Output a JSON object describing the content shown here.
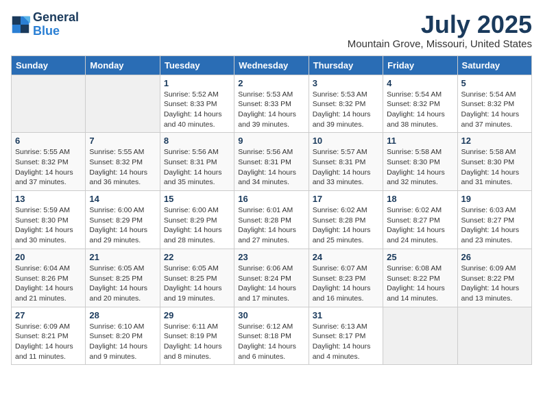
{
  "logo": {
    "line1": "General",
    "line2": "Blue"
  },
  "title": "July 2025",
  "location": "Mountain Grove, Missouri, United States",
  "headers": [
    "Sunday",
    "Monday",
    "Tuesday",
    "Wednesday",
    "Thursday",
    "Friday",
    "Saturday"
  ],
  "weeks": [
    [
      {
        "day": "",
        "empty": true
      },
      {
        "day": "",
        "empty": true
      },
      {
        "day": "1",
        "sunrise": "Sunrise: 5:52 AM",
        "sunset": "Sunset: 8:33 PM",
        "daylight": "Daylight: 14 hours and 40 minutes."
      },
      {
        "day": "2",
        "sunrise": "Sunrise: 5:53 AM",
        "sunset": "Sunset: 8:33 PM",
        "daylight": "Daylight: 14 hours and 39 minutes."
      },
      {
        "day": "3",
        "sunrise": "Sunrise: 5:53 AM",
        "sunset": "Sunset: 8:32 PM",
        "daylight": "Daylight: 14 hours and 39 minutes."
      },
      {
        "day": "4",
        "sunrise": "Sunrise: 5:54 AM",
        "sunset": "Sunset: 8:32 PM",
        "daylight": "Daylight: 14 hours and 38 minutes."
      },
      {
        "day": "5",
        "sunrise": "Sunrise: 5:54 AM",
        "sunset": "Sunset: 8:32 PM",
        "daylight": "Daylight: 14 hours and 37 minutes."
      }
    ],
    [
      {
        "day": "6",
        "sunrise": "Sunrise: 5:55 AM",
        "sunset": "Sunset: 8:32 PM",
        "daylight": "Daylight: 14 hours and 37 minutes."
      },
      {
        "day": "7",
        "sunrise": "Sunrise: 5:55 AM",
        "sunset": "Sunset: 8:32 PM",
        "daylight": "Daylight: 14 hours and 36 minutes."
      },
      {
        "day": "8",
        "sunrise": "Sunrise: 5:56 AM",
        "sunset": "Sunset: 8:31 PM",
        "daylight": "Daylight: 14 hours and 35 minutes."
      },
      {
        "day": "9",
        "sunrise": "Sunrise: 5:56 AM",
        "sunset": "Sunset: 8:31 PM",
        "daylight": "Daylight: 14 hours and 34 minutes."
      },
      {
        "day": "10",
        "sunrise": "Sunrise: 5:57 AM",
        "sunset": "Sunset: 8:31 PM",
        "daylight": "Daylight: 14 hours and 33 minutes."
      },
      {
        "day": "11",
        "sunrise": "Sunrise: 5:58 AM",
        "sunset": "Sunset: 8:30 PM",
        "daylight": "Daylight: 14 hours and 32 minutes."
      },
      {
        "day": "12",
        "sunrise": "Sunrise: 5:58 AM",
        "sunset": "Sunset: 8:30 PM",
        "daylight": "Daylight: 14 hours and 31 minutes."
      }
    ],
    [
      {
        "day": "13",
        "sunrise": "Sunrise: 5:59 AM",
        "sunset": "Sunset: 8:30 PM",
        "daylight": "Daylight: 14 hours and 30 minutes."
      },
      {
        "day": "14",
        "sunrise": "Sunrise: 6:00 AM",
        "sunset": "Sunset: 8:29 PM",
        "daylight": "Daylight: 14 hours and 29 minutes."
      },
      {
        "day": "15",
        "sunrise": "Sunrise: 6:00 AM",
        "sunset": "Sunset: 8:29 PM",
        "daylight": "Daylight: 14 hours and 28 minutes."
      },
      {
        "day": "16",
        "sunrise": "Sunrise: 6:01 AM",
        "sunset": "Sunset: 8:28 PM",
        "daylight": "Daylight: 14 hours and 27 minutes."
      },
      {
        "day": "17",
        "sunrise": "Sunrise: 6:02 AM",
        "sunset": "Sunset: 8:28 PM",
        "daylight": "Daylight: 14 hours and 25 minutes."
      },
      {
        "day": "18",
        "sunrise": "Sunrise: 6:02 AM",
        "sunset": "Sunset: 8:27 PM",
        "daylight": "Daylight: 14 hours and 24 minutes."
      },
      {
        "day": "19",
        "sunrise": "Sunrise: 6:03 AM",
        "sunset": "Sunset: 8:27 PM",
        "daylight": "Daylight: 14 hours and 23 minutes."
      }
    ],
    [
      {
        "day": "20",
        "sunrise": "Sunrise: 6:04 AM",
        "sunset": "Sunset: 8:26 PM",
        "daylight": "Daylight: 14 hours and 21 minutes."
      },
      {
        "day": "21",
        "sunrise": "Sunrise: 6:05 AM",
        "sunset": "Sunset: 8:25 PM",
        "daylight": "Daylight: 14 hours and 20 minutes."
      },
      {
        "day": "22",
        "sunrise": "Sunrise: 6:05 AM",
        "sunset": "Sunset: 8:25 PM",
        "daylight": "Daylight: 14 hours and 19 minutes."
      },
      {
        "day": "23",
        "sunrise": "Sunrise: 6:06 AM",
        "sunset": "Sunset: 8:24 PM",
        "daylight": "Daylight: 14 hours and 17 minutes."
      },
      {
        "day": "24",
        "sunrise": "Sunrise: 6:07 AM",
        "sunset": "Sunset: 8:23 PM",
        "daylight": "Daylight: 14 hours and 16 minutes."
      },
      {
        "day": "25",
        "sunrise": "Sunrise: 6:08 AM",
        "sunset": "Sunset: 8:22 PM",
        "daylight": "Daylight: 14 hours and 14 minutes."
      },
      {
        "day": "26",
        "sunrise": "Sunrise: 6:09 AM",
        "sunset": "Sunset: 8:22 PM",
        "daylight": "Daylight: 14 hours and 13 minutes."
      }
    ],
    [
      {
        "day": "27",
        "sunrise": "Sunrise: 6:09 AM",
        "sunset": "Sunset: 8:21 PM",
        "daylight": "Daylight: 14 hours and 11 minutes."
      },
      {
        "day": "28",
        "sunrise": "Sunrise: 6:10 AM",
        "sunset": "Sunset: 8:20 PM",
        "daylight": "Daylight: 14 hours and 9 minutes."
      },
      {
        "day": "29",
        "sunrise": "Sunrise: 6:11 AM",
        "sunset": "Sunset: 8:19 PM",
        "daylight": "Daylight: 14 hours and 8 minutes."
      },
      {
        "day": "30",
        "sunrise": "Sunrise: 6:12 AM",
        "sunset": "Sunset: 8:18 PM",
        "daylight": "Daylight: 14 hours and 6 minutes."
      },
      {
        "day": "31",
        "sunrise": "Sunrise: 6:13 AM",
        "sunset": "Sunset: 8:17 PM",
        "daylight": "Daylight: 14 hours and 4 minutes."
      },
      {
        "day": "",
        "empty": true
      },
      {
        "day": "",
        "empty": true
      }
    ]
  ]
}
